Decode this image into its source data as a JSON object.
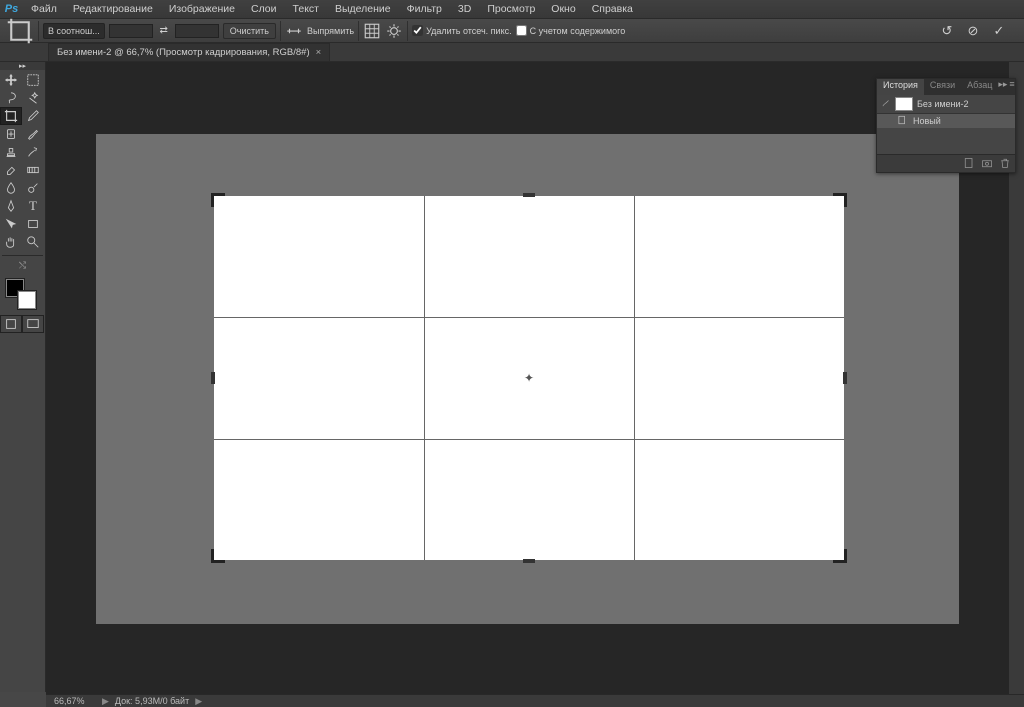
{
  "app": {
    "logo": "Ps"
  },
  "menu": {
    "items": [
      "Файл",
      "Редактирование",
      "Изображение",
      "Слои",
      "Текст",
      "Выделение",
      "Фильтр",
      "3D",
      "Просмотр",
      "Окно",
      "Справка"
    ]
  },
  "options": {
    "aspect_preset": "В соотнош...",
    "width": "",
    "height": "",
    "clear": "Очистить",
    "straighten": "Выпрямить",
    "delete_cropped": "Удалить отсеч. пикс.",
    "content_aware": "С учетом содержимого"
  },
  "doctab": {
    "title": "Без имени-2 @ 66,7% (Просмотр кадрирования, RGB/8#)",
    "close": "×"
  },
  "history": {
    "tabs": [
      "История",
      "Связи",
      "Абзац"
    ],
    "doc_name": "Без имени-2",
    "step1": "Новый"
  },
  "status": {
    "zoom": "66,67%",
    "doc_info": "Док: 5,93M/0 байт"
  },
  "tools": {
    "names": [
      "move-tool",
      "marquee-tool",
      "lasso-tool",
      "magic-wand-tool",
      "crop-tool",
      "eyedropper-tool",
      "healing-tool",
      "brush-tool",
      "stamp-tool",
      "history-brush-tool",
      "eraser-tool",
      "gradient-tool",
      "blur-tool",
      "dodge-tool",
      "pen-tool",
      "type-tool",
      "path-tool",
      "shape-tool",
      "hand-tool",
      "zoom-tool"
    ]
  }
}
